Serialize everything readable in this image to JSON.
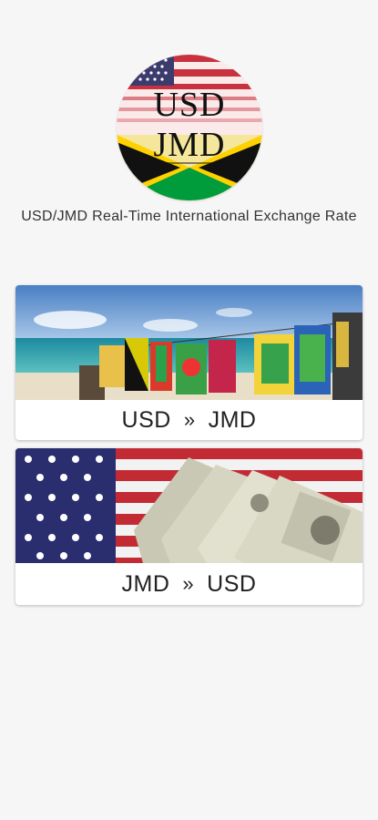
{
  "logo": {
    "line1": "USD",
    "line2": "JMD"
  },
  "subtitle": "USD/JMD Real-Time International Exchange Rate",
  "cards": [
    {
      "from": "USD",
      "arrow": "»",
      "to": "JMD"
    },
    {
      "from": "JMD",
      "arrow": "»",
      "to": "USD"
    }
  ],
  "colors": {
    "background": "#f6f6f6",
    "us_red": "#b22234",
    "us_blue": "#3c3b6e",
    "jm_green": "#009b3a",
    "jm_gold": "#fed100"
  }
}
